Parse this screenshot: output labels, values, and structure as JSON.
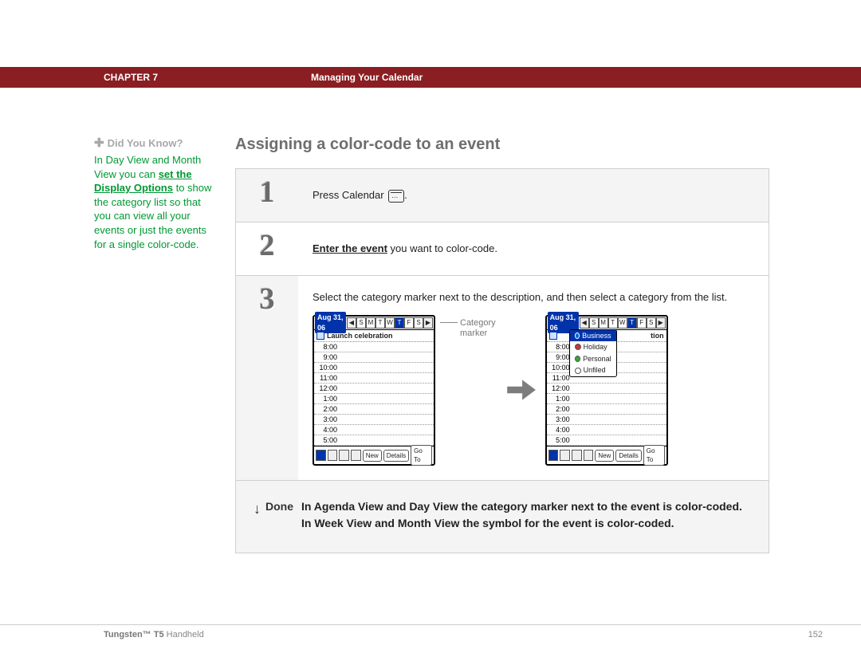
{
  "header": {
    "chapter": "CHAPTER 7",
    "title": "Managing Your Calendar"
  },
  "sidebar": {
    "dyk_label": "Did You Know?",
    "dyk_pre": "In Day View and Month View you can ",
    "dyk_link": "set the Display Options",
    "dyk_post": " to show the category list so that you can view all your events or just the events for a single color-code."
  },
  "main": {
    "heading": "Assigning a color-code to an event",
    "steps": {
      "s1": {
        "num": "1",
        "text_pre": "Press Calendar ",
        "text_post": "."
      },
      "s2": {
        "num": "2",
        "link": "Enter the event",
        "text_post": " you want to color-code."
      },
      "s3": {
        "num": "3",
        "text": "Select the category marker next to the description, and then select a category from the list."
      }
    },
    "done": {
      "label": "Done",
      "text": "In Agenda View and Day View the category marker next to the event is color-coded. In Week View and Month View the symbol for the event is color-coded."
    }
  },
  "screenshots": {
    "date": "Aug 31, 06",
    "days": [
      "S",
      "M",
      "T",
      "W",
      "T",
      "F",
      "S"
    ],
    "event1": "Launch celebration",
    "event2_suffix": "tion",
    "times": [
      "8:00",
      "9:00",
      "10:00",
      "11:00",
      "12:00",
      "1:00",
      "2:00",
      "3:00",
      "4:00",
      "5:00"
    ],
    "btn_new": "New",
    "btn_details": "Details",
    "btn_goto": "Go To",
    "popup": [
      "Business",
      "Holiday",
      "Personal",
      "Unfiled"
    ],
    "marker_label_l1": "Category",
    "marker_label_l2": "marker"
  },
  "footer": {
    "product_bold": "Tungsten™ T5",
    "product_rest": " Handheld",
    "page": "152"
  }
}
